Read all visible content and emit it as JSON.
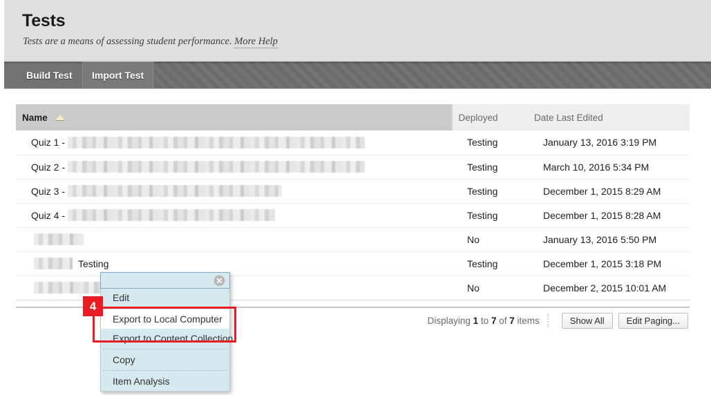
{
  "header": {
    "title": "Tests",
    "description": "Tests are a means of assessing student performance.",
    "more_help_label": "More Help"
  },
  "action_bar": {
    "buttons": [
      {
        "label": "Build Test",
        "name": "build-test-button"
      },
      {
        "label": "Import Test",
        "name": "import-test-button"
      }
    ]
  },
  "table": {
    "columns": [
      {
        "label": "Name",
        "sorted": true,
        "sort_direction": "asc"
      },
      {
        "label": "Deployed",
        "sorted": false
      },
      {
        "label": "Date Last Edited",
        "sorted": false
      }
    ],
    "rows": [
      {
        "name_prefix": "Quiz 1 -",
        "name_redacted_width": 430,
        "name_suffix": "",
        "deployed": "Testing",
        "date": "January 13, 2016 3:19 PM"
      },
      {
        "name_prefix": "Quiz 2 -",
        "name_redacted_width": 430,
        "name_suffix": "",
        "deployed": "Testing",
        "date": "March 10, 2016 5:34 PM"
      },
      {
        "name_prefix": "Quiz 3 -",
        "name_redacted_width": 310,
        "name_suffix": "",
        "deployed": "Testing",
        "date": "December 1, 2015 8:29 AM"
      },
      {
        "name_prefix": "Quiz 4 -",
        "name_redacted_width": 300,
        "name_suffix": "",
        "deployed": "Testing",
        "date": "December 1, 2015 8:28 AM"
      },
      {
        "name_prefix": "",
        "name_redacted_width": 72,
        "name_suffix": "",
        "deployed": "No",
        "date": "January 13, 2016 5:50 PM"
      },
      {
        "name_prefix": "",
        "name_redacted_width": 56,
        "name_suffix": "Testing",
        "deployed": "Testing",
        "date": "December 1, 2015 3:18 PM"
      },
      {
        "name_prefix": "",
        "name_redacted_width": 98,
        "name_suffix": "",
        "deployed": "No",
        "date": "December 2, 2015 10:01 AM"
      }
    ]
  },
  "paging": {
    "displaying_prefix": "Displaying",
    "from": "1",
    "to_word": "to",
    "to": "7",
    "of_word": "of",
    "total": "7",
    "items_word": "items",
    "show_all_label": "Show All",
    "edit_paging_label": "Edit Paging..."
  },
  "context_menu": {
    "close_title": "Close",
    "items": [
      {
        "label": "Edit",
        "hover": false,
        "separator_after": true
      },
      {
        "label": "Export to Local Computer",
        "hover": true,
        "separator_after": false
      },
      {
        "label": "Export to Content Collection",
        "hover": false,
        "separator_after": true
      },
      {
        "label": "Copy",
        "hover": false,
        "separator_after": true
      },
      {
        "label": "Item Analysis",
        "hover": false,
        "separator_after": false
      }
    ]
  },
  "annotation": {
    "badge_number": "4",
    "color": "#e81c23"
  },
  "colors": {
    "header_bg": "#e0e0e0",
    "action_bar": "#727272",
    "sorted_column": "#cbcbcb",
    "menu_bg": "#d6e9ee",
    "annotation_red": "#e81c23"
  }
}
